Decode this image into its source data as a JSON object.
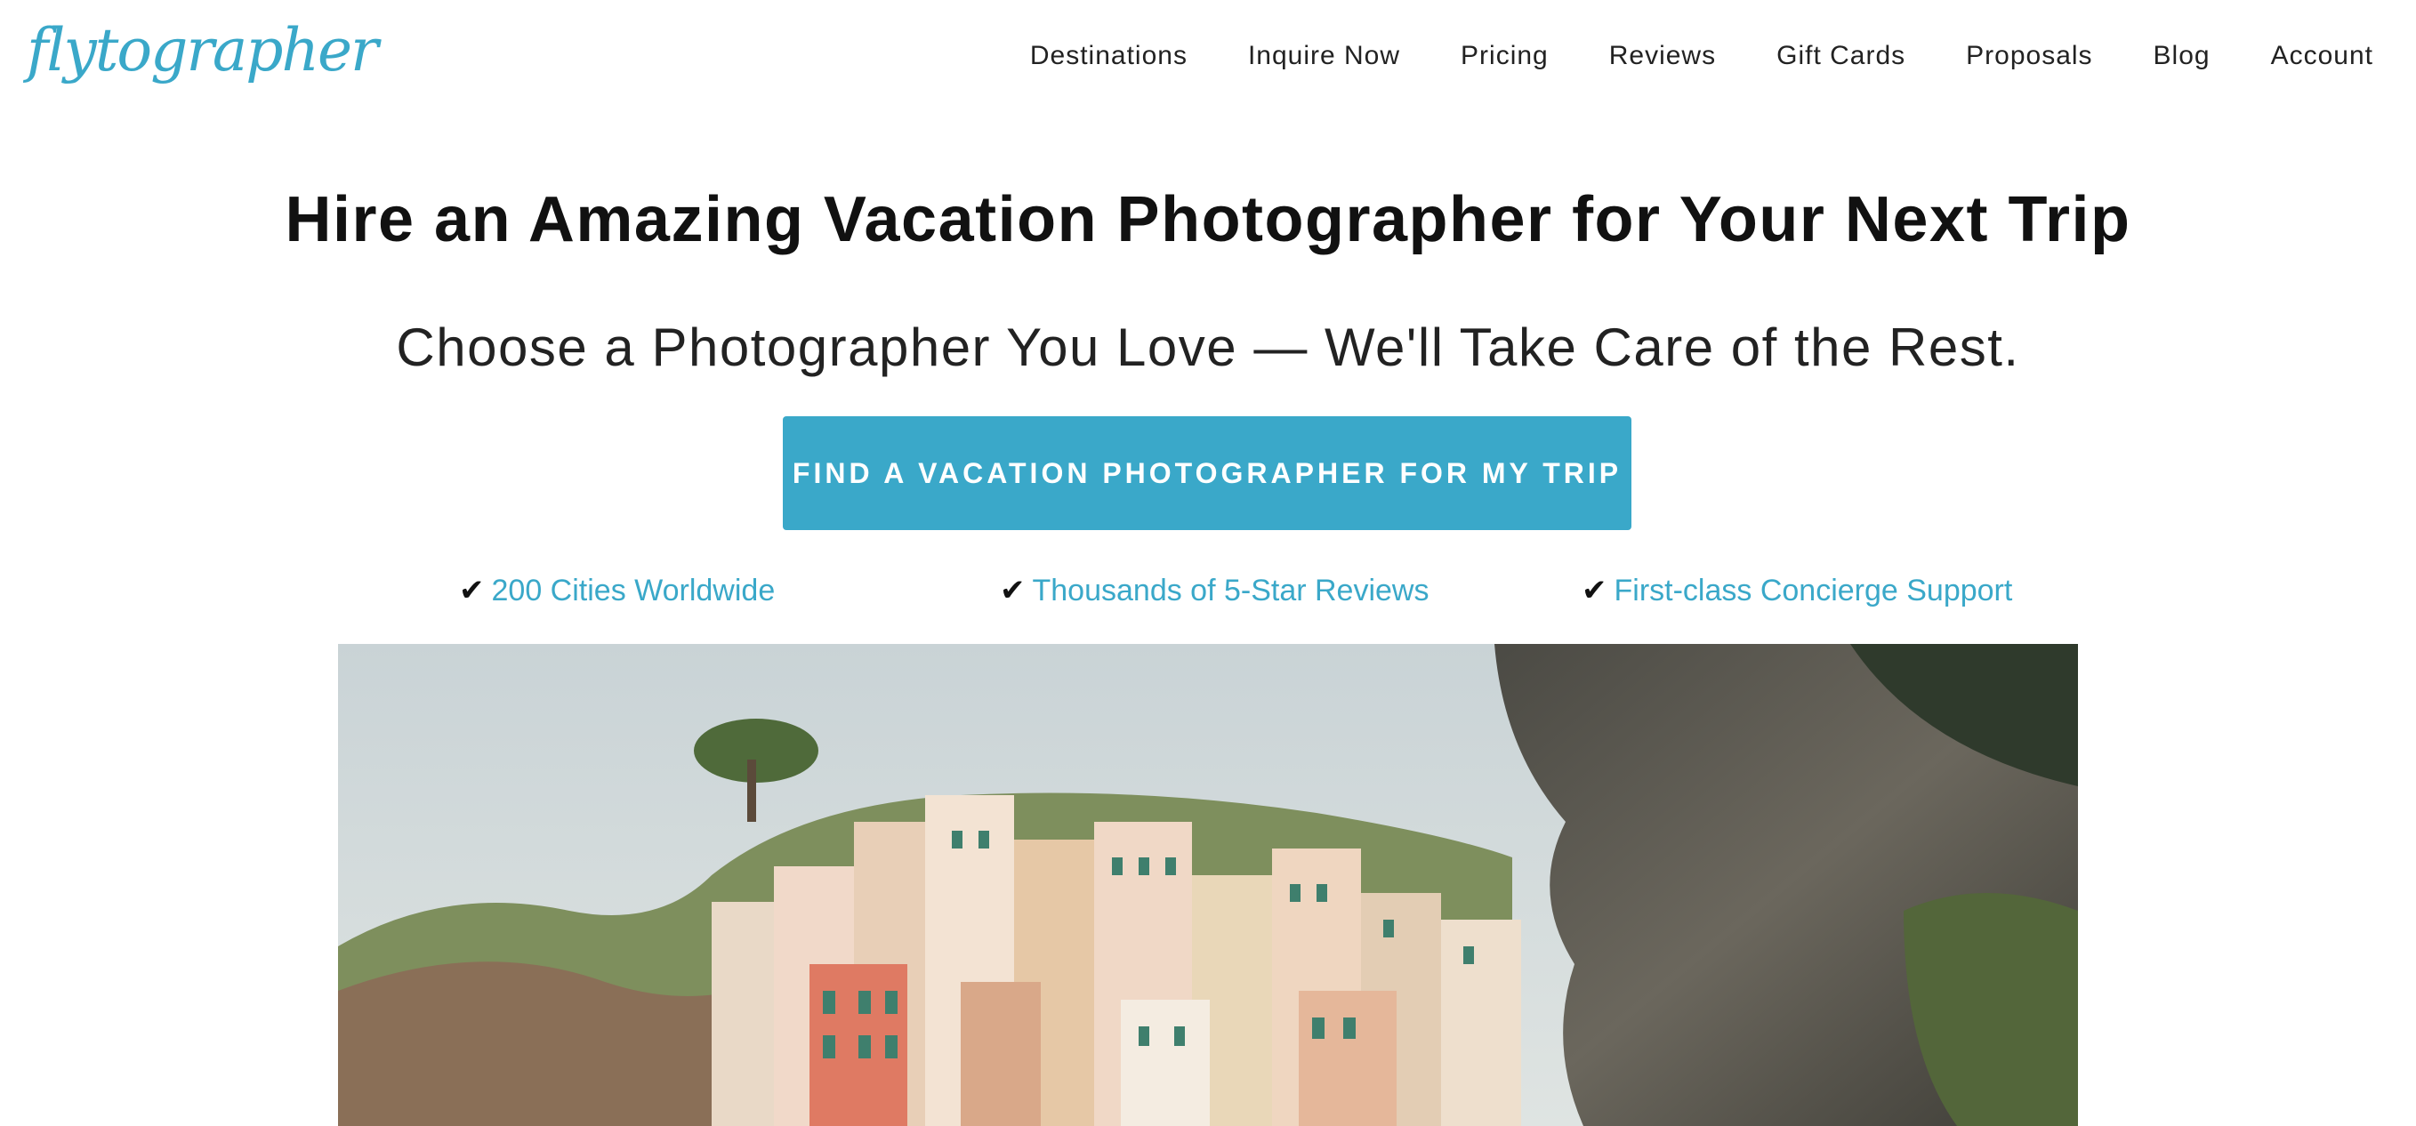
{
  "brand": {
    "logo_text": "flytographer",
    "accent_color": "#3aa8c9"
  },
  "nav": {
    "items": [
      {
        "label": "Destinations"
      },
      {
        "label": "Inquire Now"
      },
      {
        "label": "Pricing"
      },
      {
        "label": "Reviews"
      },
      {
        "label": "Gift Cards"
      },
      {
        "label": "Proposals"
      },
      {
        "label": "Blog"
      },
      {
        "label": "Account"
      }
    ]
  },
  "hero": {
    "title": "Hire an Amazing Vacation Photographer for Your Next Trip",
    "subtitle": "Choose a Photographer You Love — We'll Take Care of the Rest.",
    "cta_label": "FIND A VACATION PHOTOGRAPHER FOR MY TRIP"
  },
  "features": [
    {
      "check": "✔",
      "label": "200 Cities Worldwide"
    },
    {
      "check": "✔",
      "label": "Thousands of 5-Star Reviews"
    },
    {
      "check": "✔",
      "label": "First-class Concierge Support"
    }
  ],
  "hero_image": {
    "subject": "colorful hillside village beside a rocky cliff"
  }
}
